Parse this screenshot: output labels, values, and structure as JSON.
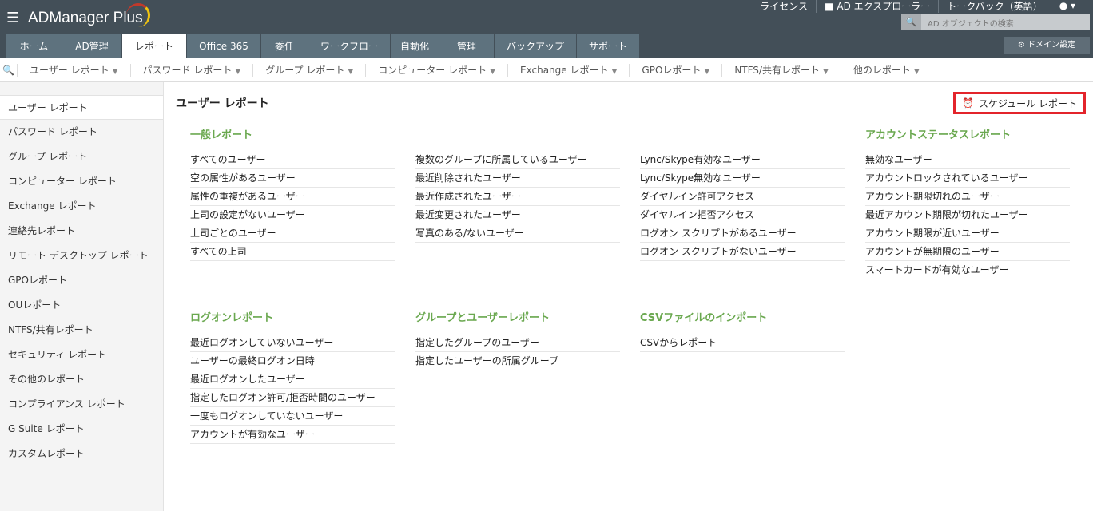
{
  "header": {
    "logo": "ADManager Plus",
    "top_links": [
      "ライセンス",
      "AD エクスプローラー",
      "トークバック（英語）"
    ],
    "search_placeholder": "AD オブジェクトの検索",
    "domain_settings": "ドメイン設定"
  },
  "tabs": [
    "ホーム",
    "AD管理",
    "レポート",
    "Office 365",
    "委任",
    "ワークフロー",
    "自動化",
    "管理",
    "バックアップ",
    "サポート"
  ],
  "active_tab": "レポート",
  "subnav": [
    "ユーザー レポート",
    "パスワード レポート",
    "グループ レポート",
    "コンピューター レポート",
    "Exchange レポート",
    "GPOレポート",
    "NTFS/共有レポート",
    "他のレポート"
  ],
  "sidebar": [
    "ユーザー レポート",
    "パスワード レポート",
    "グループ レポート",
    "コンピューター レポート",
    "Exchange レポート",
    "連絡先レポート",
    "リモート デスクトップ レポート",
    "GPOレポート",
    "OUレポート",
    "NTFS/共有レポート",
    "セキュリティ レポート",
    "その他のレポート",
    "コンプライアンス レポート",
    "G Suite レポート",
    "カスタムレポート"
  ],
  "page_title": "ユーザー レポート",
  "schedule_button": "スケジュール レポート",
  "sections": [
    {
      "title": "一般レポート",
      "items": [
        "すべてのユーザー",
        "空の属性があるユーザー",
        "属性の重複があるユーザー",
        "上司の設定がないユーザー",
        "上司ごとのユーザー",
        "すべての上司"
      ]
    },
    {
      "title": "",
      "items": [
        "複数のグループに所属しているユーザー",
        "最近削除されたユーザー",
        "最近作成されたユーザー",
        "最近変更されたユーザー",
        "写真のある/ないユーザー"
      ]
    },
    {
      "title": "",
      "items": [
        "Lync/Skype有効なユーザー",
        "Lync/Skype無効なユーザー",
        "ダイヤルイン許可アクセス",
        "ダイヤルイン拒否アクセス",
        "ログオン スクリプトがあるユーザー",
        "ログオン スクリプトがないユーザー"
      ]
    },
    {
      "title": "アカウントステータスレポート",
      "items": [
        "無効なユーザー",
        "アカウントロックされているユーザー",
        "アカウント期限切れのユーザー",
        "最近アカウント期限が切れたユーザー",
        "アカウント期限が近いユーザー",
        "アカウントが無期限のユーザー",
        "スマートカードが有効なユーザー"
      ]
    },
    {
      "title": "ログオンレポート",
      "items": [
        "最近ログオンしていないユーザー",
        "ユーザーの最終ログオン日時",
        "最近ログオンしたユーザー",
        "指定したログオン許可/拒否時間のユーザー",
        "一度もログオンしていないユーザー",
        "アカウントが有効なユーザー"
      ]
    },
    {
      "title": "グループとユーザーレポート",
      "items": [
        "指定したグループのユーザー",
        "指定したユーザーの所属グループ"
      ]
    },
    {
      "title": "CSVファイルのインポート",
      "items": [
        "CSVからレポート"
      ]
    }
  ]
}
